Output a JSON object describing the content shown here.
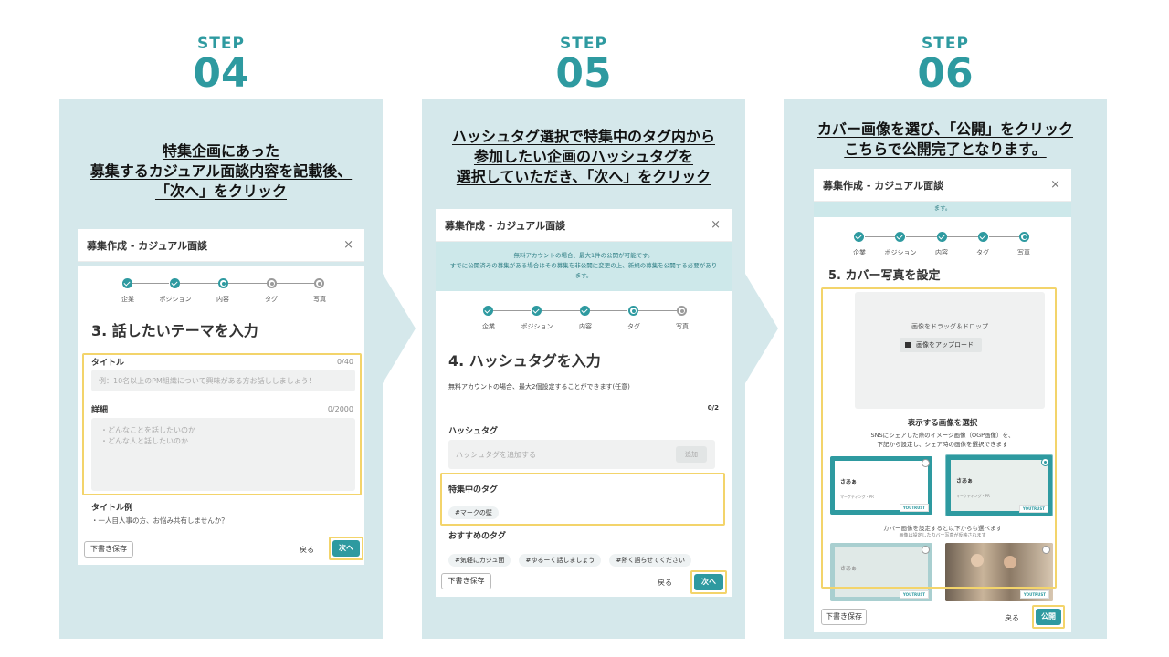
{
  "steps": [
    {
      "label": "STEP",
      "number": "04",
      "caption": [
        "特集企画にあった",
        "募集するカジュアル面談内容を記載後、",
        "「次へ」をクリック"
      ],
      "modal": {
        "title": "募集作成 - カジュアル面談",
        "close": "×",
        "stepper": [
          "企業",
          "ポジション",
          "内容",
          "タグ",
          "写真"
        ],
        "section_title": "3. 話したいテーマを入力",
        "title_label": "タイトル",
        "title_counter": "0/40",
        "title_placeholder": "例：10名以上のPM組織について興味がある方お話ししましょう！",
        "detail_label": "詳細",
        "detail_counter": "0/2000",
        "detail_placeholder_1": "・どんなことを話したいのか",
        "detail_placeholder_2": "・どんな人と話したいのか",
        "example_label": "タイトル例",
        "example_text": "・一人目人事の方、お悩み共有しませんか？",
        "draft_button": "下書き保存",
        "back_button": "戻る",
        "next_button": "次へ"
      }
    },
    {
      "label": "STEP",
      "number": "05",
      "caption": [
        "ハッシュタグ選択で特集中のタグ内から",
        "参加したい企画のハッシュタグを",
        "選択していただき、「次へ」をクリック"
      ],
      "modal": {
        "title": "募集作成 - カジュアル面談",
        "close": "×",
        "notice_1": "無料アカウントの場合、最大1件の公開が可能です。",
        "notice_2": "すでに公開済みの募集がある場合はその募集を非公開に変更の上、新規の募集を公開する必要があり",
        "notice_3": "ます。",
        "stepper": [
          "企業",
          "ポジション",
          "内容",
          "タグ",
          "写真"
        ],
        "section_title": "4. ハッシュタグを入力",
        "description": "無料アカウントの場合、最大2個設定することができます(任意)",
        "counter": "0/2",
        "hashtag_label": "ハッシュタグ",
        "hashtag_placeholder": "ハッシュタグを追加する",
        "add_button": "追加",
        "featured_label": "特集中のタグ",
        "featured_tags": [
          "#マークの壁"
        ],
        "recommended_label": "おすすめのタグ",
        "recommended_tags": [
          "#気軽にカジュ面",
          "#ゆるーく話しましょう",
          "#熱く語らせてください"
        ],
        "draft_button": "下書き保存",
        "back_button": "戻る",
        "next_button": "次へ"
      }
    },
    {
      "label": "STEP",
      "number": "06",
      "caption": [
        "カバー画像を選び、「公開」をクリック",
        "こちらで公開完了となります。"
      ],
      "modal": {
        "title": "募集作成 - カジュアル面談",
        "close": "×",
        "notice_tail": "ます。",
        "stepper": [
          "企業",
          "ポジション",
          "内容",
          "タグ",
          "写真"
        ],
        "section_title": "5. カバー写真を設定",
        "dropzone_text": "画像をドラッグ＆ドロップ",
        "upload_button": "画像をアップロード",
        "display_title": "表示する画像を選択",
        "display_desc_1": "SNSにシェアした際のイメージ画像（OGP画像）を、",
        "display_desc_2": "下記から設定し、シェア時の画像を選択できます",
        "ogp_text": "さあぁ",
        "ogp_logo": "YOUTRUST",
        "ogp_sub": "マーケティング・PR",
        "cover_note_1": "カバー画像を設定すると以下からも選べます",
        "cover_note_2": "画像は設定したカバー写真が反映されます",
        "draft_button": "下書き保存",
        "back_button": "戻る",
        "publish_button": "公開"
      }
    }
  ],
  "colors": {
    "accent": "#2e9aa0",
    "panel": "#d5e8eb",
    "highlight": "#f3d46b"
  }
}
